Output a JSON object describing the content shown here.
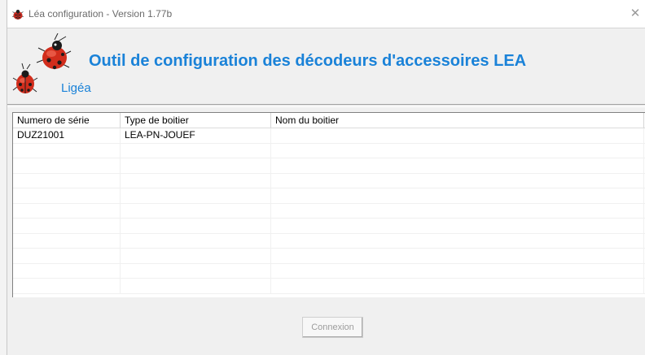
{
  "window": {
    "title": "Léa configuration - Version 1.77b",
    "close_label": "✕"
  },
  "header": {
    "heading": "Outil de configuration des décodeurs d'accessoires LEA",
    "brand": "Ligéa",
    "accent_color": "#1a82d8"
  },
  "table": {
    "columns": [
      "Numero de série",
      "Type de boitier",
      "Nom du boitier",
      ""
    ],
    "rows": [
      [
        "DUZ21001",
        "LEA-PN-JOUEF",
        "",
        ""
      ],
      [
        "",
        "",
        "",
        ""
      ],
      [
        "",
        "",
        "",
        ""
      ],
      [
        "",
        "",
        "",
        ""
      ],
      [
        "",
        "",
        "",
        ""
      ],
      [
        "",
        "",
        "",
        ""
      ],
      [
        "",
        "",
        "",
        ""
      ],
      [
        "",
        "",
        "",
        ""
      ],
      [
        "",
        "",
        "",
        ""
      ],
      [
        "",
        "",
        "",
        ""
      ],
      [
        "",
        "",
        "",
        ""
      ]
    ]
  },
  "actions": {
    "connect_label": "Connexion"
  },
  "icons": {
    "app": "ladybug-icon",
    "logo": "ladybug-logo-icon",
    "close": "close-icon"
  }
}
